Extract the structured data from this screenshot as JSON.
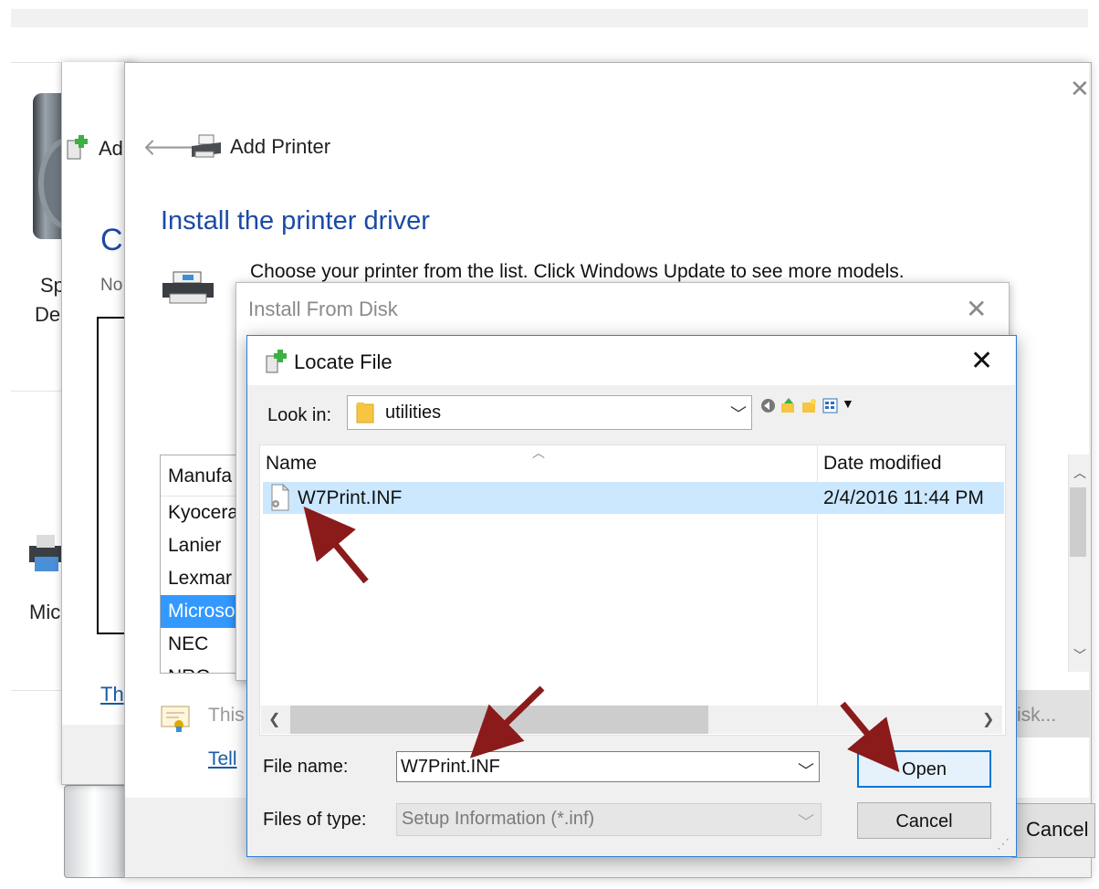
{
  "background": {
    "left_labels": [
      "Sp",
      "De",
      "Mic"
    ]
  },
  "back_window": {
    "title": "Ad",
    "heading": "Cl",
    "subtext": "No",
    "link": "Th"
  },
  "add_printer": {
    "title": "Add Printer",
    "heading": "Install the printer driver",
    "description": "Choose your printer from the list. Click Windows Update to see more models.",
    "manufacturer_header": "Manufa",
    "manufacturers": [
      "Kyocera",
      "Lanier",
      "Lexmar",
      "Microso",
      "NEC",
      "NRG"
    ],
    "selected_manufacturer_index": 3,
    "cert_text": "This",
    "tell_link": "Tell",
    "have_disk_label": "isk...",
    "cancel_label": "Cancel"
  },
  "install_from_disk": {
    "title": "Install From Disk"
  },
  "locate_file": {
    "title": "Locate File",
    "look_in_label": "Look in:",
    "look_in_value": "utilities",
    "columns": {
      "name": "Name",
      "date_modified": "Date modified"
    },
    "files": [
      {
        "name": "W7Print.INF",
        "date_modified": "2/4/2016 11:44 PM",
        "selected": true
      }
    ],
    "file_name_label": "File name:",
    "file_name_value": "W7Print.INF",
    "files_of_type_label": "Files of type:",
    "files_of_type_value": "Setup Information (*.inf)",
    "open_label": "Open",
    "cancel_label": "Cancel"
  },
  "colors": {
    "heading_blue": "#1b4aa5",
    "selection_blue": "#3399ff",
    "row_selected": "#cce8ff",
    "annotation_red": "#8b1a1a",
    "dialog_border": "#2d7fd6"
  }
}
